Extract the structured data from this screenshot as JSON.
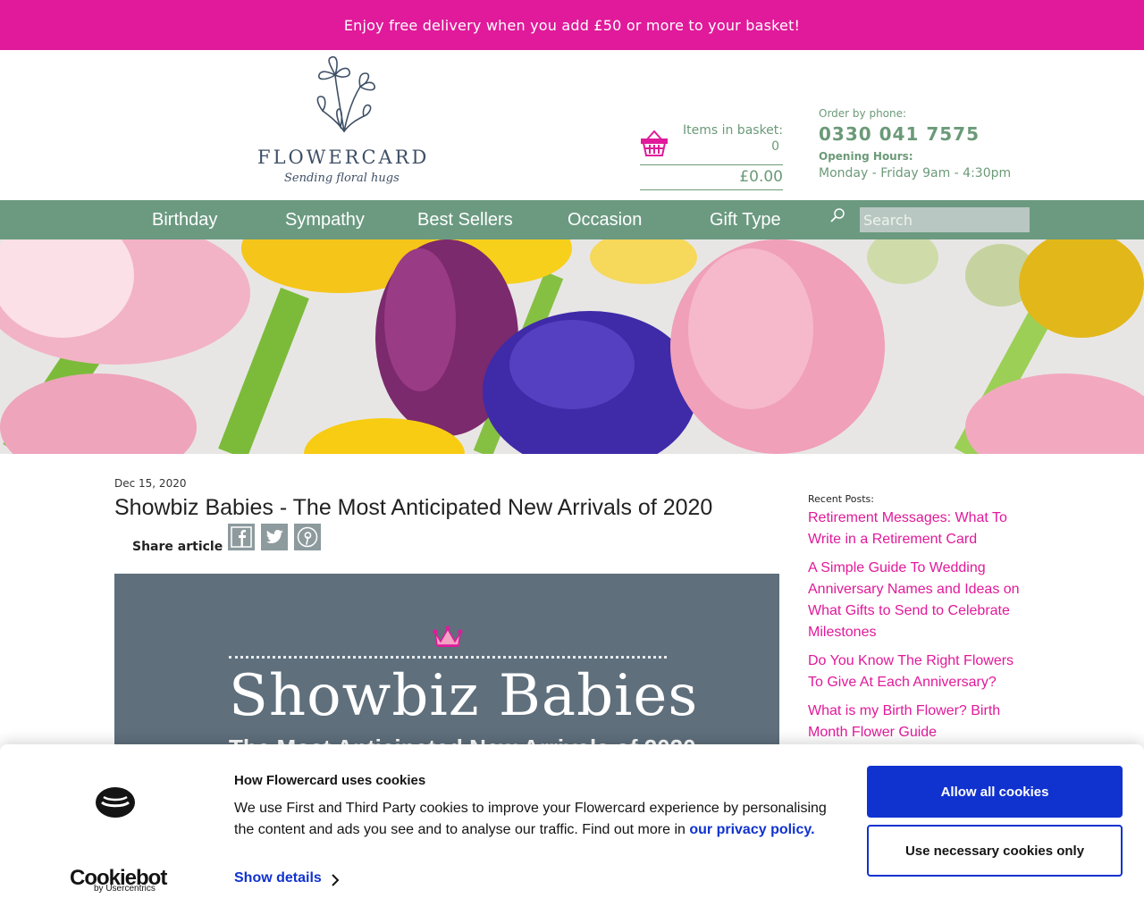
{
  "promo": {
    "text": "Enjoy free delivery when you add £50 or more to your basket!"
  },
  "header": {
    "brand": "FLOWERCARD",
    "tagline": "Sending floral hugs",
    "basket": {
      "items_label": "Items in basket:",
      "items_count": "0",
      "total": "£0.00"
    },
    "contact": {
      "order_label": "Order by phone:",
      "phone": "0330 041 7575",
      "hours_label": "Opening Hours:",
      "hours": "Monday - Friday 9am - 4:30pm"
    }
  },
  "nav": {
    "items": [
      "Birthday",
      "Sympathy",
      "Best Sellers",
      "Occasion",
      "Gift Type"
    ],
    "search_placeholder": "Search"
  },
  "article": {
    "date": "Dec 15, 2020",
    "title": "Showbiz Babies - The Most Anticipated New Arrivals of 2020",
    "share_label": "Share article",
    "share_icons": [
      "facebook-icon",
      "twitter-icon",
      "pinterest-icon"
    ],
    "image_title": "Showbiz Babies",
    "image_subtitle": "The Most Anticipated New Arrivals of 2020"
  },
  "sidebar": {
    "heading": "Recent Posts:",
    "posts": [
      "Retirement Messages: What To Write in a Retirement Card",
      "A Simple Guide To Wedding Anniversary Names and Ideas on What Gifts to Send to Celebrate Milestones",
      "Do You Know The Right Flowers To Give At Each Anniversary?",
      "What is my Birth Flower? Birth Month Flower Guide"
    ]
  },
  "cookie": {
    "brand": "Cookiebot",
    "brand_sub": "by Usercentrics",
    "title": "How Flowercard uses cookies",
    "body": "We use First and Third Party cookies to improve your Flowercard experience by personalising the content and ads you see and to analyse our traffic. Find out more in ",
    "policy_link": "our privacy policy.",
    "show_details": "Show details",
    "allow_all": "Allow all cookies",
    "necessary_only": "Use necessary cookies only"
  },
  "colors": {
    "promo": "#e01a9a",
    "nav": "#6b9a80",
    "accent_green": "#6b9a78",
    "link_pink": "#e01a9a",
    "cookie_blue": "#1032cf"
  }
}
